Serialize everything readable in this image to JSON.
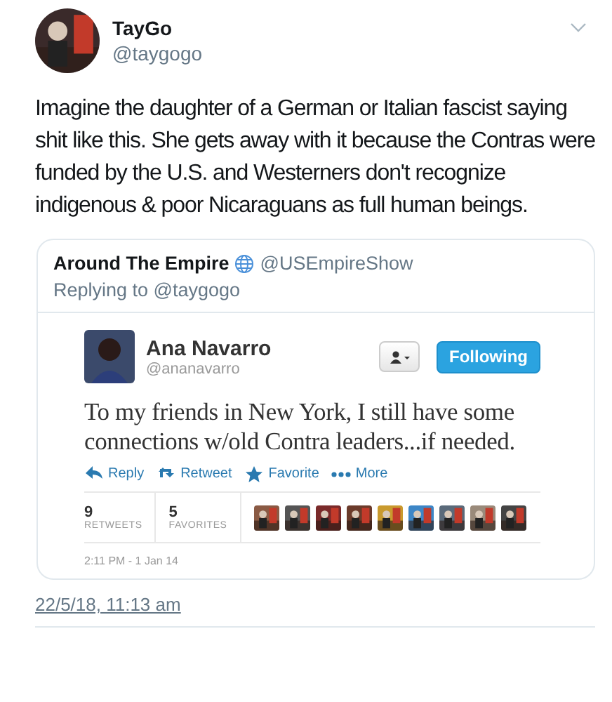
{
  "tweet": {
    "name": "TayGo",
    "handle": "@taygogo",
    "text": "Imagine the daughter of a German or Italian fascist saying shit like this. She gets away with it because the Contras were funded by the U.S. and Westerners don't recognize indigenous & poor Nicaraguans as full human beings.",
    "timestamp": "22/5/18, 11:13 am"
  },
  "quote": {
    "name": "Around The Empire",
    "handle": "@USEmpireShow",
    "replying": "Replying to @taygogo",
    "embedded": {
      "avatar": {
        "kind": "silhouette"
      },
      "name": "Ana Navarro",
      "handle": "@ananavarro",
      "follow_button": "Following",
      "text": "To my friends in New York, I still have some connections w/old Contra leaders...if needed.",
      "actions": [
        {
          "kind": "reply",
          "label": "Reply"
        },
        {
          "kind": "retweet",
          "label": "Retweet"
        },
        {
          "kind": "favorite",
          "label": "Favorite"
        },
        {
          "kind": "more",
          "label": "More"
        }
      ],
      "stats": [
        {
          "count": "9",
          "label": "RETWEETS"
        },
        {
          "count": "5",
          "label": "FAVORITES"
        }
      ],
      "time": "2:11 PM - 1 Jan 14"
    }
  }
}
